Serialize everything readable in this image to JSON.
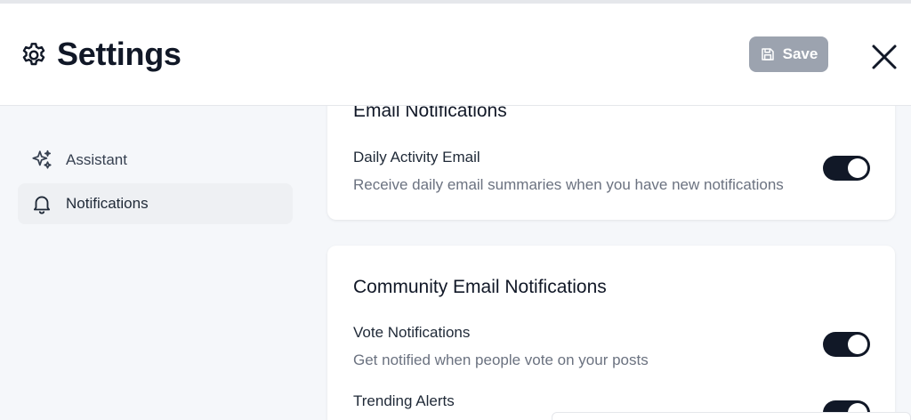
{
  "header": {
    "title": "Settings",
    "save_label": "Save",
    "icon": "gear-icon",
    "close_icon": "close-icon"
  },
  "sidebar": {
    "items": [
      {
        "label": "Assistant",
        "icon": "sparkles-icon",
        "active": false
      },
      {
        "label": "Notifications",
        "icon": "bell-icon",
        "active": true
      }
    ]
  },
  "main": {
    "email_notifications": {
      "title": "Email Notifications",
      "settings": [
        {
          "label": "Daily Activity Email",
          "description": "Receive daily email summaries when you have new notifications",
          "enabled": true
        }
      ]
    },
    "community_notifications": {
      "title": "Community Email Notifications",
      "settings": [
        {
          "label": "Vote Notifications",
          "description": "Get notified when people vote on your posts",
          "enabled": true
        },
        {
          "label": "Trending Alerts",
          "enabled": true
        }
      ]
    }
  },
  "colors": {
    "toggle_on": "#111827",
    "save_button_disabled": "#9ca3af",
    "active_item_bg": "#eef0f3",
    "page_bg": "#f5f7fa"
  }
}
